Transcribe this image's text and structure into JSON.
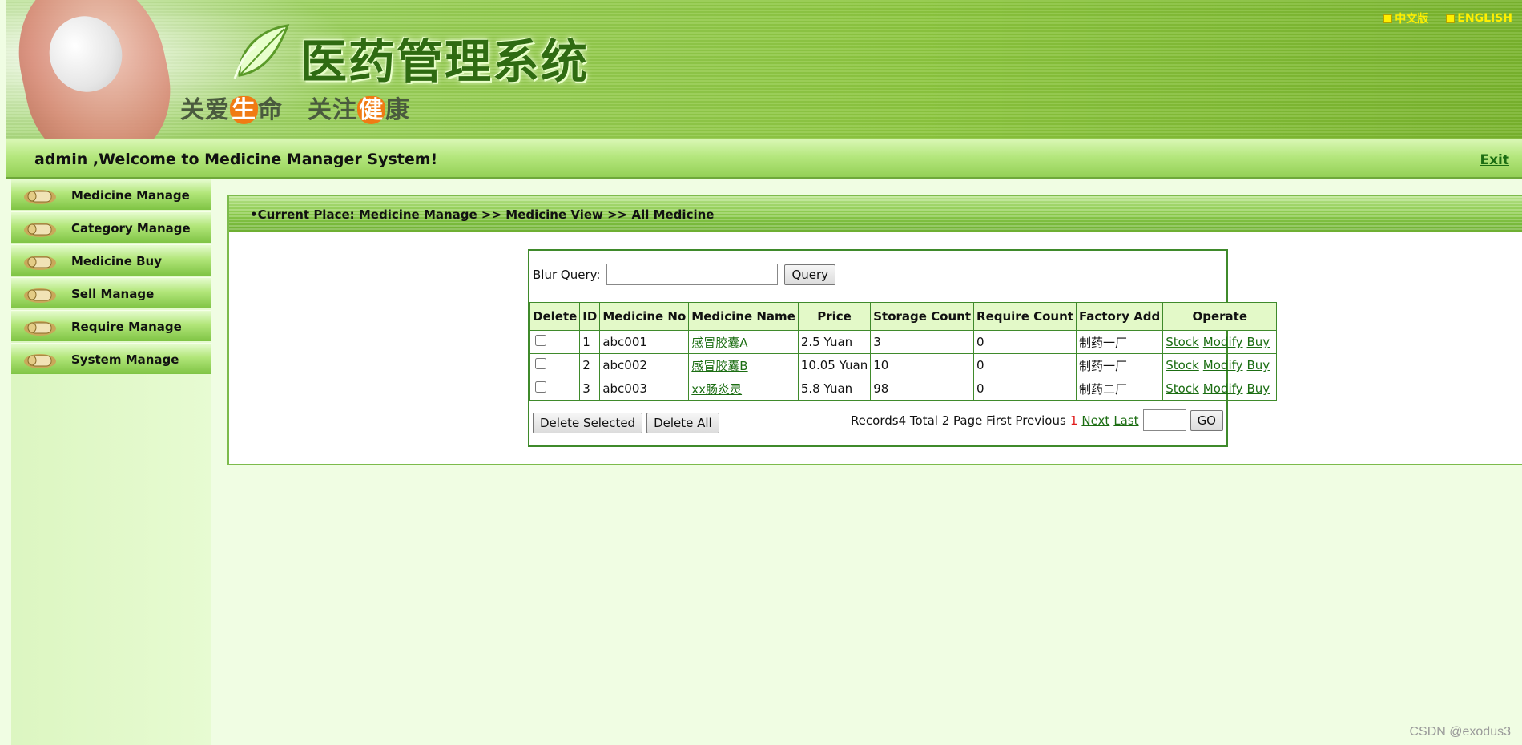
{
  "header": {
    "title_zh": "医药管理系统",
    "slogan_part1": "关爱",
    "slogan_hl1": "生",
    "slogan_part2": "命　关注",
    "slogan_hl2": "健",
    "slogan_part3": "康",
    "lang_zh": "中文版",
    "lang_en": "ENGLISH"
  },
  "welcome": {
    "message": "admin ,Welcome to Medicine Manager System!",
    "exit_label": "Exit"
  },
  "sidebar": {
    "items": [
      {
        "label": "Medicine Manage"
      },
      {
        "label": "Category Manage"
      },
      {
        "label": "Medicine Buy"
      },
      {
        "label": "Sell Manage"
      },
      {
        "label": "Require Manage"
      },
      {
        "label": "System Manage"
      }
    ]
  },
  "breadcrumb": {
    "text": "•Current Place:   Medicine Manage >> Medicine View >> All Medicine"
  },
  "query": {
    "label": "Blur Query:",
    "value": "",
    "button": "Query"
  },
  "table": {
    "headers": [
      "Delete",
      "ID",
      "Medicine No",
      "Medicine Name",
      "Price",
      "Storage Count",
      "Require Count",
      "Factory Add",
      "Operate"
    ],
    "rows": [
      {
        "id": "1",
        "no": "abc001",
        "name": "感冒胶囊A",
        "price": "2.5 Yuan",
        "storage": "3",
        "require": "0",
        "factory": "制药一厂"
      },
      {
        "id": "2",
        "no": "abc002",
        "name": "感冒胶囊B",
        "price": "10.05 Yuan",
        "storage": "10",
        "require": "0",
        "factory": "制药一厂"
      },
      {
        "id": "3",
        "no": "abc003",
        "name": "xx肠炎灵",
        "price": "5.8 Yuan",
        "storage": "98",
        "require": "0",
        "factory": "制药二厂"
      }
    ],
    "ops": {
      "stock": "Stock",
      "modify": "Modify",
      "buy": "Buy"
    }
  },
  "footer": {
    "delete_selected": "Delete Selected",
    "delete_all": "Delete All",
    "pager_text": "Records4 Total 2 Page First Previous",
    "current_page": "1",
    "next": "Next",
    "last": "Last",
    "go_value": "",
    "go_button": "GO"
  },
  "watermark": "CSDN @exodus3"
}
